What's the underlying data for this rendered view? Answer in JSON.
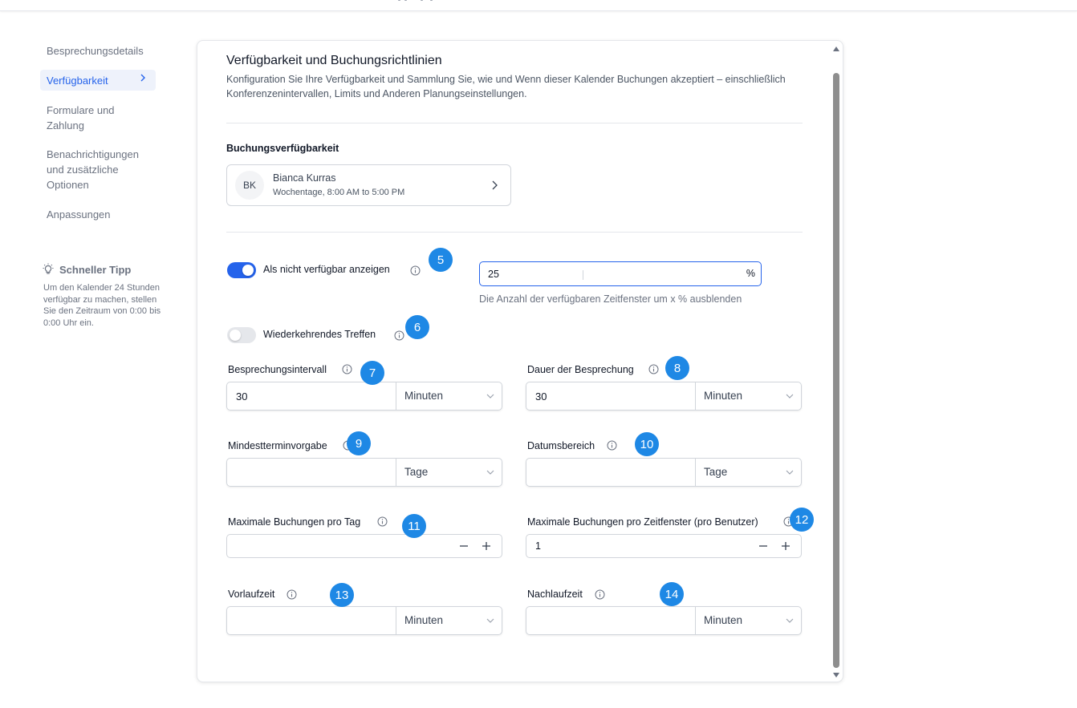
{
  "sidebar": {
    "items": [
      {
        "label": "Besprechungsdetails"
      },
      {
        "label": "Verfügbarkeit"
      },
      {
        "label": "Formulare und Zahlung"
      },
      {
        "label": "Benachrichtigungen und zusätzliche Optionen"
      },
      {
        "label": "Anpassungen"
      }
    ],
    "tip": {
      "title": "Schneller Tipp",
      "text": "Um den Kalender 24 Stunden verfügbar zu machen, stellen Sie den Zeitraum von 0:00 bis 0:00 Uhr ein."
    }
  },
  "main": {
    "title": "Verfügbarkeit und Buchungsrichtlinien",
    "description": "Konfiguration Sie Ihre Verfügbarkeit und Sammlung Sie, wie und Wenn dieser Kalender Buchungen akzeptiert – einschließlich Konferenzenintervallen, Limits und Anderen Planungseinstellungen.",
    "availability": {
      "section_label": "Buchungsverfügbarkeit",
      "initials": "BK",
      "name": "Bianca Kurras",
      "schedule": "Wochentage, 8:00 AM to 5:00 PM"
    },
    "hide_unavailable": {
      "label": "Als nicht verfügbar anzeigen",
      "on": true,
      "value": "25",
      "suffix": "%",
      "help": "Die Anzahl der verfügbaren Zeitfenster um x % ausblenden"
    },
    "recurring": {
      "label": "Wiederkehrendes Treffen",
      "on": false
    },
    "fields": {
      "interval": {
        "label": "Besprechungsintervall",
        "value": "30",
        "unit": "Minuten"
      },
      "duration": {
        "label": "Dauer der Besprechung",
        "value": "30",
        "unit": "Minuten"
      },
      "min_notice": {
        "label": "Mindestterminvorgabe",
        "value": "",
        "unit": "Tage"
      },
      "date_range": {
        "label": "Datumsbereich",
        "value": "",
        "unit": "Tage"
      },
      "max_per_day": {
        "label": "Maximale Buchungen pro Tag",
        "value": ""
      },
      "max_per_slot": {
        "label": "Maximale Buchungen pro Zeitfenster (pro Benutzer)",
        "value": "1"
      },
      "pre_buffer": {
        "label": "Vorlaufzeit",
        "value": "",
        "unit": "Minuten"
      },
      "post_buffer": {
        "label": "Nachlaufzeit",
        "value": "",
        "unit": "Minuten"
      }
    }
  },
  "badges": [
    "5",
    "6",
    "7",
    "8",
    "9",
    "10",
    "11",
    "12",
    "13",
    "14"
  ],
  "colors": {
    "accent": "#2563eb",
    "badge": "#1e88e5",
    "muted": "#6b7280"
  }
}
